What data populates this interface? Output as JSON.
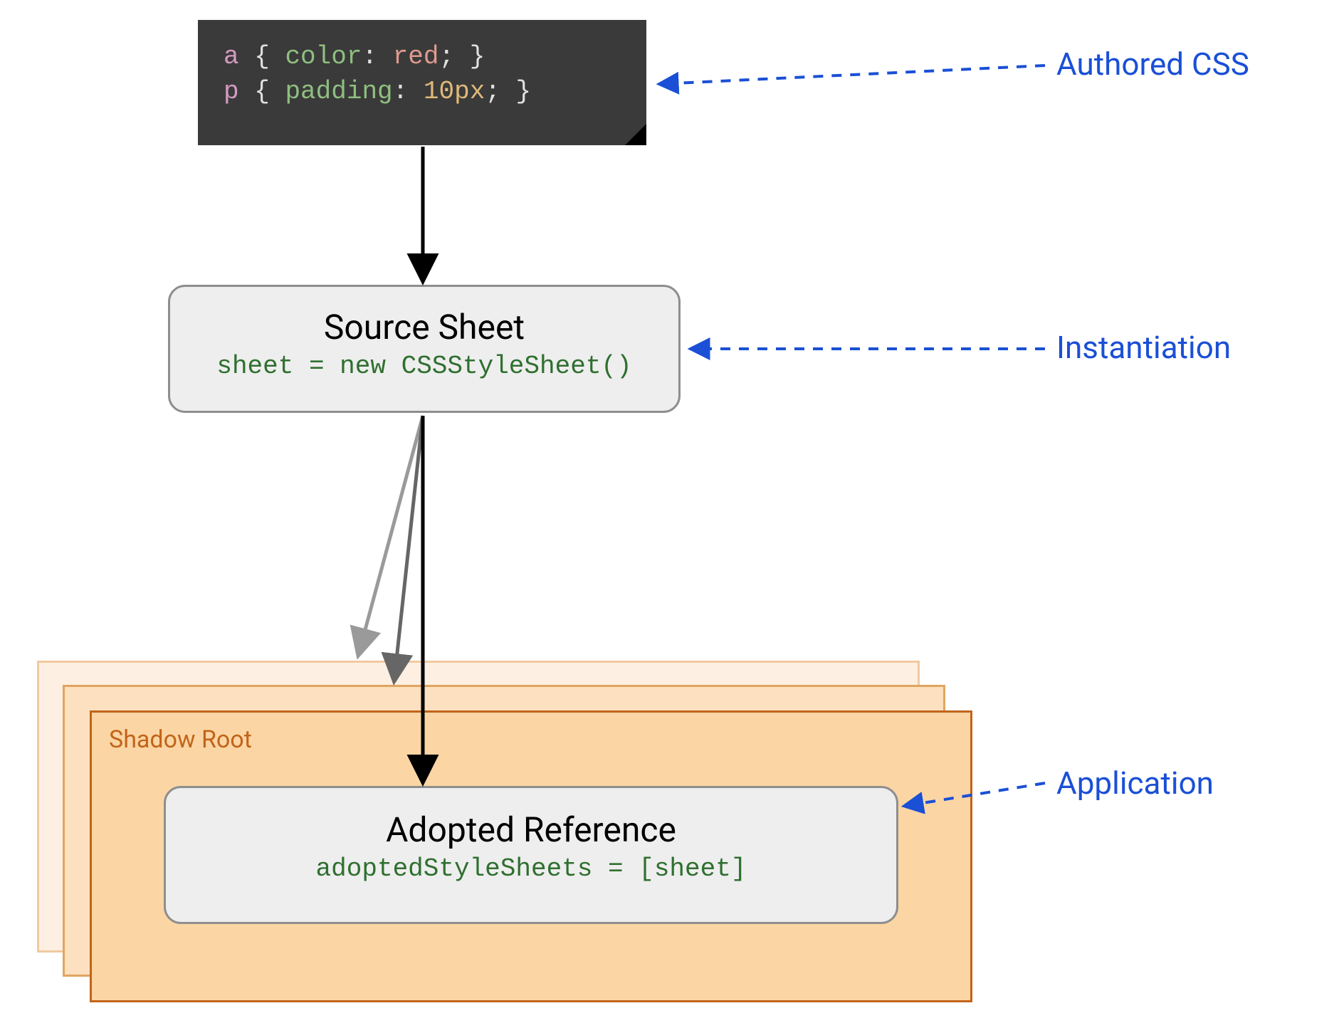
{
  "code": {
    "rule1": {
      "selector": "a",
      "property": "color",
      "value": "red"
    },
    "rule2": {
      "selector": "p",
      "property": "padding",
      "value_num": "10",
      "value_unit": "px"
    }
  },
  "source_sheet": {
    "title": "Source Sheet",
    "code": "sheet = new CSSStyleSheet()"
  },
  "shadow_root": {
    "label": "Shadow Root"
  },
  "adopted": {
    "title": "Adopted Reference",
    "code": "adoptedStyleSheets = [sheet]"
  },
  "annotations": {
    "authored": "Authored CSS",
    "instantiation": "Instantiation",
    "application": "Application"
  }
}
